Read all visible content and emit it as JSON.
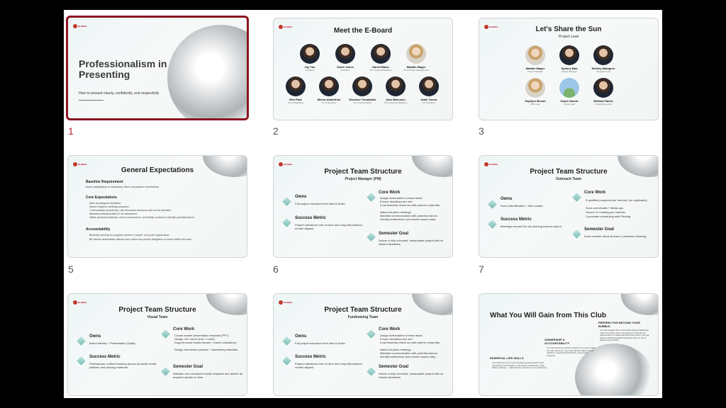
{
  "slide_numbers": [
    "1",
    "2",
    "3",
    "5",
    "6",
    "7"
  ],
  "s1": {
    "logo": "GLOBAL",
    "title": "Professionalism in Presenting",
    "subtitle": "How to present clearly, confidently, and respectfully"
  },
  "s2": {
    "title": "Meet the E-Board",
    "row1": [
      {
        "name": "Joy Yun",
        "role": "President"
      },
      {
        "name": "Owen Jones",
        "role": "President"
      },
      {
        "name": "Garret Baker",
        "role": "VP of Internal Relations"
      },
      {
        "name": "Maddie Mager",
        "role": "VP of Project Management"
      }
    ],
    "row2": [
      {
        "name": "Erin Park",
        "role": "VP of Marketing"
      },
      {
        "name": "Merna Abdelrhim",
        "role": "VP of Secretary"
      },
      {
        "name": "Sherisse Tomadakis",
        "role": "VP of Social Media"
      },
      {
        "name": "Alex Marcucci",
        "role": "VP of External Relations"
      },
      {
        "name": "Katie Torres",
        "role": "VP of Finance"
      }
    ]
  },
  "s3": {
    "title": "Let's Share the Sun",
    "subtitle": "Project Lead",
    "row1": [
      {
        "name": "Maddie Mager",
        "role": "Project Manager"
      },
      {
        "name": "Sydney Mak",
        "role": "Project Manager"
      },
      {
        "name": "Shelley Malngren",
        "role": "Outreach Lead"
      }
    ],
    "row2": [
      {
        "name": "Sephyre Brown",
        "role": "PPD Lead"
      },
      {
        "name": "Kayra Garcia",
        "role": "Visual Lead"
      },
      {
        "name": "Michael Harris",
        "role": "Fundraising Lead"
      }
    ]
  },
  "s5": {
    "title": "General Expectations",
    "baseline_h": "Baseline Requirement",
    "baseline_t": "Active participation is mandatory; this is not passive membership",
    "core_h": "Core Expectations",
    "core_items": [
      "Meet all assigned deadlines",
      "Attend required meetings prepared",
      "Communicate proactively; note discussed absences will not be tolerated",
      "Maintain professionalism in all interactions",
      "Utilize personal networks, alumni connections, and family contacts to identify potential donors"
    ],
    "acc_h": "Accountability",
    "acc_items": [
      "Biweekly meeting for progress report to \"pause\" non-profit organization",
      "Be missed deliverables without prior notice and proper delegation of merch within the team"
    ]
  },
  "s6": {
    "title": "Project Team Structure",
    "subtitle": "Project Manager (PM)",
    "owns_h": "Owns",
    "owns_t": "Full project execution from start to finish",
    "metric_h": "Success Metric",
    "metric_t": "Project milestones met on time and nonprofit partners remain aligned",
    "core_h": "Core Work",
    "core_items": [
      "Assign deliverables to team leads",
      "Ensure deadlines are met",
      "Lead biweekly check ins with partner nonprofits",
      "Attend all pitch meetings",
      "Maintain communication with potential donors",
      "Identify bottlenecks and resolve issues early"
    ],
    "goal_h": "Semester Goal",
    "goal_t": "Deliver a fully executed, measurable project with no missed deadlines"
  },
  "s7": {
    "title": "Project Team Structure",
    "subtitle": "Outreach Team",
    "owns_h": "Owns",
    "owns_t": "Donor identification + first contact",
    "metric_h": "Success Metric",
    "metric_t": "Meetings secured for the pitching team to step in.",
    "core_h": "Core Work",
    "core_items": [
      "5 qualified prospects per member (no duplicates)",
      "Send cold emails + follow-ups",
      "Secure ≥1 meeting per member",
      "Coordinate scheduling with Pitching"
    ],
    "goal_h": "Semester Goal",
    "goal_t": "Each member lands at least 2 confirmed meeting."
  },
  "s8": {
    "title": "Project Team Structure",
    "subtitle": "Visual Team",
    "owns_h": "Owns",
    "owns_t": "Brand identity + Presentation Quality",
    "metric_h": "Success Metric",
    "metric_t": "Professional, unified branding across all social media platform and pitching materials.",
    "core_h": "Core Work",
    "core_items": [
      "Create master presentation template (PPT)",
      "Design GIC merch (hat + t-shirt)",
      "Support social media visuals + brand consistency",
      "Design recruitment posters + advertising materials"
    ],
    "goal_h": "Semester Goal",
    "goal_t": "Maintain one consistent master template and deliver all required visuals on time."
  },
  "s9": {
    "title": "Project Team Structure",
    "subtitle": "Fundraising Team",
    "owns_h": "Owns",
    "owns_t": "Full project execution from start to finish",
    "metric_h": "Success Metric",
    "metric_t": "Project milestones met on time and nonprofit partners remain aligned",
    "core_h": "Core Work",
    "core_items": [
      "Assign deliverables to team leads",
      "Ensure deadlines are met",
      "Lead biweekly check ins with partner nonprofits",
      "Attend all pitch meetings",
      "Maintain communication with potential donors",
      "Identify bottlenecks and resolve issues early"
    ],
    "goal_h": "Semester Goal",
    "goal_t": "Deliver a fully executed, measurable project with no missed deadlines"
  },
  "s10": {
    "title": "What You Will Gain from This Club",
    "c1_h": "ESSENTIAL LIFE SKILLS",
    "c1_t": "You will learn how to communicate professionally, build persuasive presentations, and speak confidently in high-stakes settings — skills that are relevant in any profession.",
    "c2_h": "OWNERSHIP & ACCOUNTABILITY",
    "c2_t": "You will experience what it means to be responsible for real outcomes. Your work directly affects donor relations, nonprofit partnerships, and project progress.",
    "c3_h": "PERSPECTIVE BEYOND YOUR BUBBLE",
    "c3_t": "You will engage with communities facing challenges most of us have never experienced. Through our partnerships in Guatemala and Puerto Rico, you will better understand global inequities and our role in advancing the effort."
  }
}
